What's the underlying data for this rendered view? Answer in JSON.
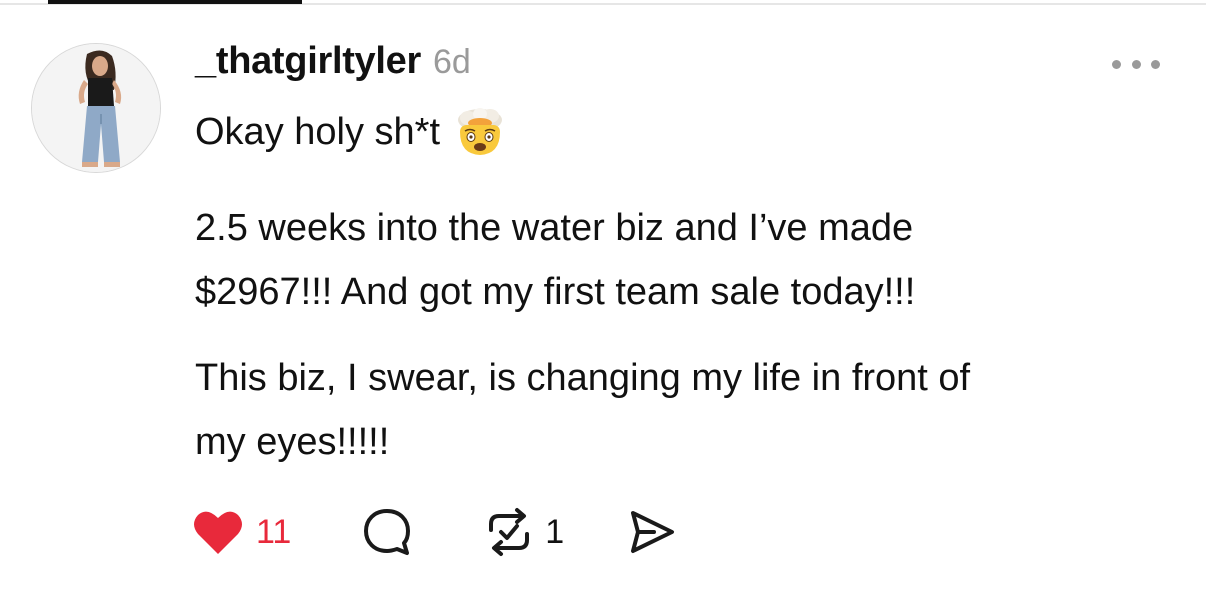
{
  "post": {
    "username": "_thatgirltyler",
    "timestamp": "6d",
    "line1": "Okay holy sh*t",
    "emoji": "exploding-head-emoji",
    "paragraph2": "2.5 weeks into the water biz and I’ve made\n$2967!!! And got my first team sale today!!!",
    "paragraph3": "This biz, I swear, is changing my life in front of\nmy eyes!!!!!"
  },
  "actions": {
    "like_count": "11",
    "like_state": "liked",
    "like_color": "#e8293b",
    "repost_count": "1"
  },
  "icons": {
    "more": "more-horizontal-icon",
    "like": "heart-icon",
    "comment": "comment-bubble-icon",
    "repost": "repost-icon",
    "share": "send-icon"
  }
}
